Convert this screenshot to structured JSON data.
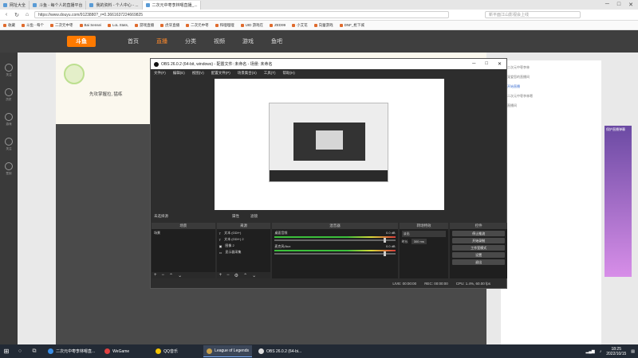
{
  "browser": {
    "tabs": [
      {
        "label": "网址大全"
      },
      {
        "label": "斗鱼 - 每个人的直播平台"
      },
      {
        "label": "我的资料 - 个人中心 - ..."
      },
      {
        "label": "二次元中枣李林嗯直播_..."
      }
    ],
    "address": "https://www.douyu.com/9123880?_r=0.3661637224669825",
    "search_placeholder": "新平面江山影视会上线",
    "bookmarks": [
      "收藏",
      "斗鱼 - 每个",
      "二次元中枣",
      "Bai Sensei",
      "LoL Stats,",
      "游戏直播",
      "虎牙直播",
      "二次元中枣",
      "和哩哩哩",
      "UID 游戏在",
      "ZED99",
      "小艾花",
      "向蕾游戏",
      "DNF_枪下城"
    ]
  },
  "site": {
    "nav": [
      "首页",
      "直播",
      "分类",
      "视频",
      "游戏",
      "鱼吧"
    ],
    "leftrail": [
      "关注",
      "历史",
      "游戏",
      "关注",
      "签到"
    ],
    "room_title": "先攻掌握拉, 猛练",
    "rightpanel": [
      "二次元中枣李林",
      "宠爱您的直播间",
      "开始直播",
      "二次元中枣李林嗯",
      "直播间"
    ],
    "ad_text": "保护直播弹幕"
  },
  "obs": {
    "title": "OBS 26.0.2 (64-bit, windows) - 配置文件: 未命名 - 场景: 未命名",
    "menu": [
      "文件(F)",
      "编辑(E)",
      "视图(V)",
      "配置文件(P)",
      "场景集合(S)",
      "工具(T)",
      "帮助(H)"
    ],
    "status_left": "未选择源",
    "status_buttons": [
      "属性",
      "滤镜"
    ],
    "docks": {
      "scenes": {
        "header": "场景",
        "items": [
          "场景"
        ]
      },
      "sources": {
        "header": "来源",
        "items": [
          "文本 (GDI+)",
          "文本 (GDI+) 2",
          "图像 2",
          "显示器采集"
        ]
      },
      "mixer": {
        "header": "混音器",
        "items": [
          {
            "name": "桌面音频",
            "db": "0.0 dB"
          },
          {
            "name": "麦克风/Aux",
            "db": "0.0 dB"
          }
        ]
      },
      "transitions": {
        "header": "转场特效",
        "type": "淡出",
        "duration_label": "时长",
        "duration": "300 ms"
      },
      "controls": {
        "header": "控件",
        "buttons": [
          "停止推流",
          "开始录制",
          "工作室模式",
          "设置",
          "退出"
        ]
      }
    },
    "footer": {
      "live": "LIVE: 00:00:00",
      "rec": "REC: 00:00:00",
      "cpu": "CPU: 1.4%, 60.00 fps"
    }
  },
  "taskbar": {
    "apps": [
      "二次元中枣李林嗯直...",
      "WeGame",
      "QQ音乐",
      "League of Legends",
      "OBS 26.0.2 (64-bi..."
    ],
    "time": "18:25",
    "date": "2022/10/15"
  }
}
